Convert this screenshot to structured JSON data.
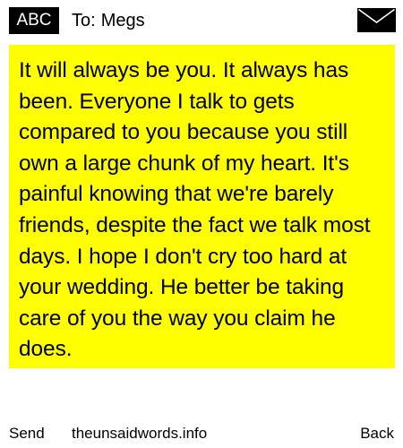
{
  "header": {
    "mode_label": "ABC",
    "to_label": "To:",
    "recipient_name": "Megs",
    "mail_icon": "envelope-icon"
  },
  "message": {
    "text": "It will always be you. It always has been. Everyone I talk to gets compared to you because you still own a large chunk of my heart. It's painful knowing that we're barely friends, despite the fact we talk most days. I hope I don't cry too hard at your wedding. He better be taking care of you the way you claim he does."
  },
  "footer": {
    "send_label": "Send",
    "site_label": "theunsaidwords.info",
    "back_label": "Back"
  },
  "colors": {
    "message_background": "#ffff00",
    "badge_background": "#000000",
    "badge_text": "#ffffff"
  }
}
